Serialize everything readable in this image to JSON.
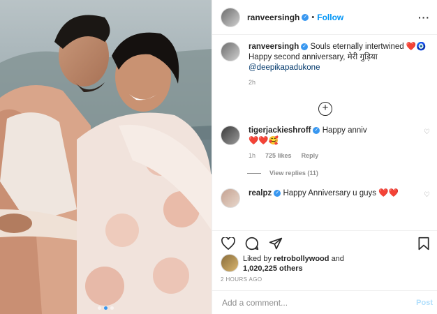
{
  "header": {
    "username": "ranveersingh",
    "follow_label": "Follow",
    "separator": "•",
    "more_label": "···"
  },
  "caption": {
    "username": "ranveersingh",
    "text_line1": "Souls eternally intertwined",
    "emoji": "❤️🧿",
    "text_line2": "Happy second anniversary, मेरी गुड़िया",
    "mention": "@deepikapadukone",
    "time": "2h"
  },
  "comments": [
    {
      "username": "tigerjackieshroff",
      "text": "Happy anniv",
      "emoji": "❤️❤️🥰",
      "time": "1h",
      "likes": "725 likes",
      "reply": "Reply",
      "view_replies": "View replies (11)"
    },
    {
      "username": "realpz",
      "text": "Happy Anniversary u guys",
      "emoji": "❤️❤️"
    }
  ],
  "likes": {
    "prefix": "Liked by",
    "user": "retrobollywood",
    "and": "and",
    "count": "1,020,225 others"
  },
  "timestamp": "2 HOURS AGO",
  "comment_box": {
    "placeholder": "Add a comment...",
    "post_label": "Post"
  },
  "carousel": {
    "count": 3,
    "active": 1
  },
  "colors": {
    "accent": "#0095f6",
    "verified": "#3897f0",
    "heart": "#ed4956",
    "jacket": "#d9a58a"
  }
}
